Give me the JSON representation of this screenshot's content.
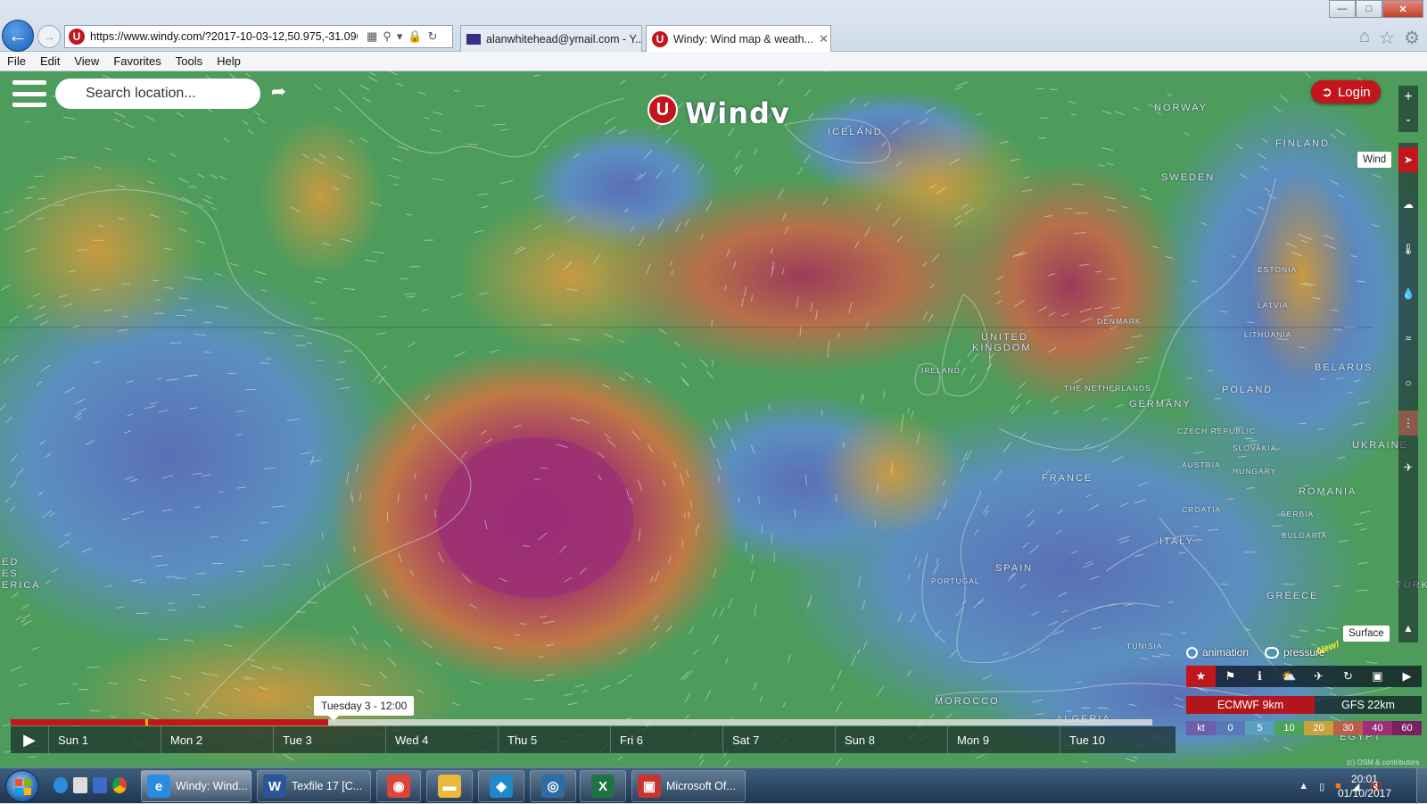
{
  "browser": {
    "url": "https://www.windy.com/?2017-10-03-12,50.975,-31.096,4",
    "tabs": [
      {
        "label": "alanwhitehead@ymail.com - Y...",
        "icon": "mail-icon"
      },
      {
        "label": "Windy: Wind map & weath...",
        "icon": "windy-logo-icon"
      }
    ],
    "menu": [
      "File",
      "Edit",
      "View",
      "Favorites",
      "Tools",
      "Help"
    ]
  },
  "windy": {
    "search_placeholder": "Search location...",
    "logo_text": "Windy",
    "login_label": "Login",
    "zoom_in": "+",
    "zoom_out": "-",
    "active_layer_tooltip": "Wind",
    "surface_tooltip": "Surface",
    "toggles": {
      "animation": "animation",
      "pressure": "pressure",
      "new_badge": "New!"
    },
    "models": {
      "primary": "ECMWF 9km",
      "secondary": "GFS 22km"
    },
    "scale": {
      "unit": "kt",
      "values": [
        "0",
        "5",
        "10",
        "20",
        "30",
        "40",
        "60"
      ],
      "colors": [
        "#6a5fa8",
        "#5a78b8",
        "#5b9fbf",
        "#4aa55a",
        "#c8a23c",
        "#b8604a",
        "#9c2f78",
        "#7a2060"
      ]
    },
    "time_tooltip": "Tuesday 3 - 12:00",
    "progress_fraction": 0.278,
    "timeline_days": [
      "Sun 1",
      "Mon 2",
      "Tue 3",
      "Wed 4",
      "Thu 5",
      "Fri 6",
      "Sat 7",
      "Sun 8",
      "Mon 9",
      "Tue 10"
    ],
    "attribution": "(c) OSM & contributors"
  },
  "map_labels": [
    {
      "text": "ICELAND",
      "size": "lg"
    },
    {
      "text": "NORWAY",
      "size": "lg"
    },
    {
      "text": "FINLAND",
      "size": "lg"
    },
    {
      "text": "SWEDEN",
      "size": "lg"
    },
    {
      "text": "ESTONIA",
      "size": "sm"
    },
    {
      "text": "LATVIA",
      "size": "sm"
    },
    {
      "text": "DENMARK",
      "size": "sm"
    },
    {
      "text": "LITHUANIA",
      "size": "sm"
    },
    {
      "text": "UNITED",
      "size": "lg"
    },
    {
      "text": "KINGDOM",
      "size": "lg"
    },
    {
      "text": "BELARUS",
      "size": "lg"
    },
    {
      "text": "IRELAND",
      "size": "sm"
    },
    {
      "text": "THE NETHERLANDS",
      "size": "sm"
    },
    {
      "text": "POLAND",
      "size": "lg"
    },
    {
      "text": "GERMANY",
      "size": "lg"
    },
    {
      "text": "CZECH REPUBLIC",
      "size": "sm"
    },
    {
      "text": "SLOVAKIA",
      "size": "sm"
    },
    {
      "text": "UKRAINE",
      "size": "lg"
    },
    {
      "text": "AUSTRIA",
      "size": "sm"
    },
    {
      "text": "HUNGARY",
      "size": "sm"
    },
    {
      "text": "FRANCE",
      "size": "lg"
    },
    {
      "text": "ROMANIA",
      "size": "lg"
    },
    {
      "text": "CROATIA",
      "size": "sm"
    },
    {
      "text": "SERBIA",
      "size": "sm"
    },
    {
      "text": "BULGARIA",
      "size": "sm"
    },
    {
      "text": "ITALY",
      "size": "lg"
    },
    {
      "text": "SPAIN",
      "size": "lg"
    },
    {
      "text": "PORTUGAL",
      "size": "sm"
    },
    {
      "text": "GREECE",
      "size": "lg"
    },
    {
      "text": "TURKE",
      "size": "lg"
    },
    {
      "text": "TUNISIA",
      "size": "sm"
    },
    {
      "text": "MOROCCO",
      "size": "lg"
    },
    {
      "text": "ALGERIA",
      "size": "lg"
    },
    {
      "text": "EGYPT",
      "size": "lg"
    },
    {
      "text": "ED",
      "size": "lg"
    },
    {
      "text": "ES",
      "size": "lg"
    },
    {
      "text": "ERICA",
      "size": "lg"
    }
  ],
  "taskbar": {
    "apps": [
      {
        "label": "Windy: Wind...",
        "icon": "internet-explorer-icon"
      },
      {
        "label": "Texfile 17 [C...",
        "icon": "word-icon"
      },
      {
        "label": "",
        "icon": "chrome-icon"
      },
      {
        "label": "",
        "icon": "folder-icon"
      },
      {
        "label": "",
        "icon": "kodi-icon"
      },
      {
        "label": "",
        "icon": "camera-icon"
      },
      {
        "label": "",
        "icon": "excel-icon"
      },
      {
        "label": "Microsoft Of...",
        "icon": "office-icon"
      }
    ],
    "time": "20:01",
    "date": "01/10/2017"
  }
}
